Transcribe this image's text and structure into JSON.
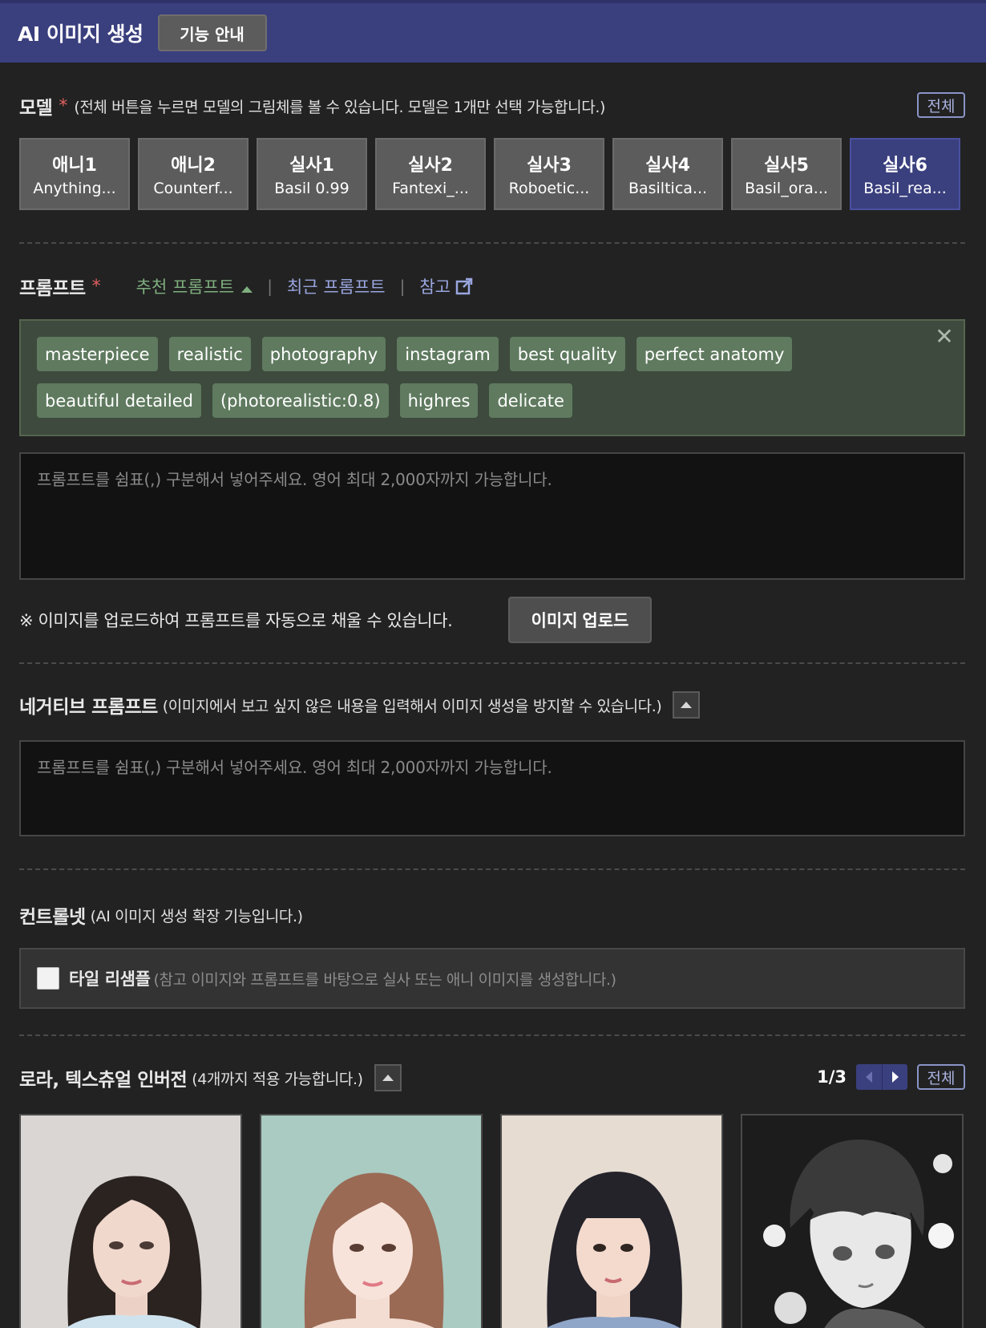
{
  "header": {
    "title": "AI 이미지 생성",
    "guide_label": "기능 안내"
  },
  "model_section": {
    "label": "모델",
    "required_mark": "*",
    "description": "(전체 버튼을 누르면 모델의 그림체를 볼 수 있습니다. 모델은 1개만 선택 가능합니다.)",
    "all_label": "전체",
    "models": [
      {
        "name": "애니1",
        "sub": "Anything...",
        "selected": false
      },
      {
        "name": "애니2",
        "sub": "Counterf...",
        "selected": false
      },
      {
        "name": "실사1",
        "sub": "Basil 0.99",
        "selected": false
      },
      {
        "name": "실사2",
        "sub": "Fantexi_...",
        "selected": false
      },
      {
        "name": "실사3",
        "sub": "Roboetic...",
        "selected": false
      },
      {
        "name": "실사4",
        "sub": "Basiltica...",
        "selected": false
      },
      {
        "name": "실사5",
        "sub": "Basil_ora...",
        "selected": false
      },
      {
        "name": "실사6",
        "sub": "Basil_rea...",
        "selected": true
      }
    ]
  },
  "prompt_section": {
    "label": "프롬프트",
    "required_mark": "*",
    "recommended_label": "추천 프롬프트",
    "recent_label": "최근 프롬프트",
    "reference_label": "참고",
    "separator": "|",
    "tags": [
      "masterpiece",
      "realistic",
      "photography",
      "instagram",
      "best quality",
      "perfect anatomy",
      "beautiful detailed",
      "(photorealistic:0.8)",
      "highres",
      "delicate"
    ],
    "close_label": "✕",
    "placeholder": "프롬프트를 쉼표(,) 구분해서 넣어주세요. 영어 최대 2,000자까지 가능합니다.",
    "value": "",
    "upload_note": "※ 이미지를 업로드하여 프롬프트를 자동으로 채울 수 있습니다.",
    "upload_label": "이미지 업로드"
  },
  "negative_section": {
    "label": "네거티브 프롬프트",
    "description": "(이미지에서 보고 싶지 않은 내용을 입력해서 이미지 생성을 방지할 수 있습니다.)",
    "placeholder": "프롬프트를 쉼표(,) 구분해서 넣어주세요. 영어 최대 2,000자까지 가능합니다.",
    "value": ""
  },
  "controlnet_section": {
    "label": "컨트롤넷",
    "description": "(AI 이미지 생성 확장 기능입니다.)",
    "option_label": "타일 리샘플",
    "option_description": "(참고 이미지와 프롬프트를 바탕으로 실사 또는 애니 이미지를 생성합니다.)",
    "checked": false
  },
  "lora_section": {
    "label": "로라, 텍스츄얼 인버전",
    "description": "(4개까지 적용 가능합니다.)",
    "page_indicator": "1/3",
    "all_label": "전체",
    "cards": [
      {
        "image": "portrait-woman-long-dark-hair"
      },
      {
        "image": "portrait-woman-brown-hair"
      },
      {
        "image": "portrait-woman-black-bangs"
      },
      {
        "image": "anime-boy-monochrome"
      }
    ]
  },
  "colors": {
    "header_bg": "#3a3f7e",
    "page_bg": "#222222",
    "selected_model": "#3a3f7e",
    "tag_bg": "#5f7a5f",
    "link_green": "#7fae7f",
    "link_blue": "#9aa6e0",
    "required": "#e06060"
  }
}
